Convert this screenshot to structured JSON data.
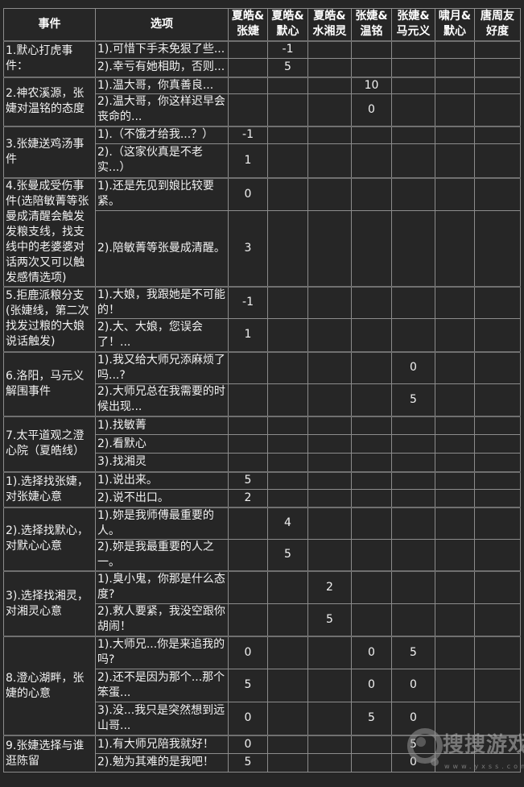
{
  "colors": {
    "background": "#262626",
    "border": "#8c8c8c",
    "text": "#f2f2f2"
  },
  "table": {
    "headers": [
      {
        "key": "event",
        "lines": [
          "事件"
        ]
      },
      {
        "key": "option",
        "lines": [
          "选项"
        ]
      },
      {
        "key": "xiahao-zhangjie",
        "lines": [
          "夏皓&",
          "张婕"
        ]
      },
      {
        "key": "xiahao-moxin",
        "lines": [
          "夏皓&",
          "默心"
        ]
      },
      {
        "key": "xiahao-shuixiangling",
        "lines": [
          "夏皓&",
          "水湘灵"
        ]
      },
      {
        "key": "zhangjie-wenming",
        "lines": [
          "张婕&",
          "温铭"
        ]
      },
      {
        "key": "zhangjie-mayuanyi",
        "lines": [
          "张婕&",
          "马元义"
        ]
      },
      {
        "key": "xiaoyue-moxin",
        "lines": [
          "啸月&",
          "默心"
        ]
      },
      {
        "key": "tangzhou-friendship",
        "lines": [
          "唐周友",
          "好度"
        ]
      }
    ],
    "groups": [
      {
        "event": "1.默心打虎事件：",
        "options": [
          {
            "text": "1).可惜下手未免狠了些...",
            "values": [
              null,
              "-1",
              null,
              null,
              null,
              null,
              null
            ]
          },
          {
            "text": "2).幸亏有她相助，否则...",
            "values": [
              null,
              "5",
              null,
              null,
              null,
              null,
              null
            ]
          }
        ]
      },
      {
        "event": "2.神农溪源，张婕对温铭的态度",
        "options": [
          {
            "text": "1).温大哥，你真善良...",
            "values": [
              null,
              null,
              null,
              "10",
              null,
              null,
              null
            ]
          },
          {
            "text": "2).温大哥，你这样迟早会丧命的...",
            "values": [
              null,
              null,
              null,
              "0",
              null,
              null,
              null
            ]
          }
        ]
      },
      {
        "event": "3.张婕送鸡汤事件",
        "options": [
          {
            "text": "1).（不饿才给我...？）",
            "values": [
              "-1",
              null,
              null,
              null,
              null,
              null,
              null
            ]
          },
          {
            "text": "2).（这家伙真是不老实...）",
            "values": [
              "1",
              null,
              null,
              null,
              null,
              null,
              null
            ]
          }
        ]
      },
      {
        "event": "4.张曼成受伤事件(选陪敏菁等张曼成清醒会触发发粮支线，找支线中的老婆婆对话两次又可以触发感情选项)",
        "options": [
          {
            "text": "1).还是先见到娘比较要紧。",
            "values": [
              "0",
              null,
              null,
              null,
              null,
              null,
              null
            ]
          },
          {
            "text": "2).陪敏菁等张曼成清醒。",
            "values": [
              "3",
              null,
              null,
              null,
              null,
              null,
              null
            ]
          }
        ]
      },
      {
        "event": "5.拒鹿派粮分支(张婕线，第二次找发过粮的大娘说话触发)",
        "options": [
          {
            "text": "1).大娘，我跟她是不可能的！",
            "values": [
              "-1",
              null,
              null,
              null,
              null,
              null,
              null
            ]
          },
          {
            "text": "2).大、大娘，您误会了！...",
            "values": [
              "1",
              null,
              null,
              null,
              null,
              null,
              null
            ]
          }
        ]
      },
      {
        "event": "6.洛阳，马元义解围事件",
        "options": [
          {
            "text": "1).我又给大师兄添麻烦了吗...?",
            "values": [
              null,
              null,
              null,
              null,
              "0",
              null,
              null
            ]
          },
          {
            "text": "2).大师兄总在我需要的时候出现...",
            "values": [
              null,
              null,
              null,
              null,
              "5",
              null,
              null
            ]
          }
        ]
      },
      {
        "event": "7.太平道观之澄心院（夏皓线）",
        "options": [
          {
            "text": "1).找敏菁",
            "values": [
              null,
              null,
              null,
              null,
              null,
              null,
              null
            ]
          },
          {
            "text": "2).看默心",
            "values": [
              null,
              null,
              null,
              null,
              null,
              null,
              null
            ]
          },
          {
            "text": "3).找湘灵",
            "values": [
              null,
              null,
              null,
              null,
              null,
              null,
              null
            ]
          }
        ]
      },
      {
        "event": "1).选择找张婕，对张婕心意",
        "options": [
          {
            "text": "1).说出来。",
            "values": [
              "5",
              null,
              null,
              null,
              null,
              null,
              null
            ]
          },
          {
            "text": "2).说不出口。",
            "values": [
              "2",
              null,
              null,
              null,
              null,
              null,
              null
            ]
          }
        ]
      },
      {
        "event": "2).选择找默心，对默心心意",
        "options": [
          {
            "text": "1).妳是我师傅最重要的人。",
            "values": [
              null,
              "4",
              null,
              null,
              null,
              null,
              null
            ]
          },
          {
            "text": "2).妳是我最重要的人之一。",
            "values": [
              null,
              "5",
              null,
              null,
              null,
              null,
              null
            ]
          }
        ]
      },
      {
        "event": "3).选择找湘灵，对湘灵心意",
        "options": [
          {
            "text": "1).臭小鬼，你那是什么态度?",
            "values": [
              null,
              null,
              "2",
              null,
              null,
              null,
              null
            ]
          },
          {
            "text": "2).救人要紧，我没空跟你胡闹！",
            "values": [
              null,
              null,
              "5",
              null,
              null,
              null,
              null
            ]
          }
        ]
      },
      {
        "event": "8.澄心湖畔，张婕的心意",
        "options": [
          {
            "text": "1).大师兄...你是来追我的吗?",
            "values": [
              "0",
              null,
              null,
              "0",
              "5",
              null,
              null
            ]
          },
          {
            "text": "2).还不是因为那个...那个笨蛋...",
            "values": [
              "5",
              null,
              null,
              "0",
              "0",
              null,
              null
            ]
          },
          {
            "text": "3).没...我只是突然想到远山哥...",
            "values": [
              "0",
              null,
              null,
              "5",
              "0",
              null,
              null
            ]
          }
        ]
      },
      {
        "event": "9.张婕选择与谁逛陈留",
        "options": [
          {
            "text": "1).有大师兄陪我就好！",
            "values": [
              "0",
              null,
              null,
              null,
              "5",
              null,
              null
            ]
          },
          {
            "text": "2).勉为其难的是我吧！",
            "values": [
              "5",
              null,
              null,
              null,
              "0",
              null,
              null
            ]
          }
        ]
      }
    ]
  },
  "watermark": {
    "title": "搜搜游戏",
    "url": "www.yxss.com"
  }
}
